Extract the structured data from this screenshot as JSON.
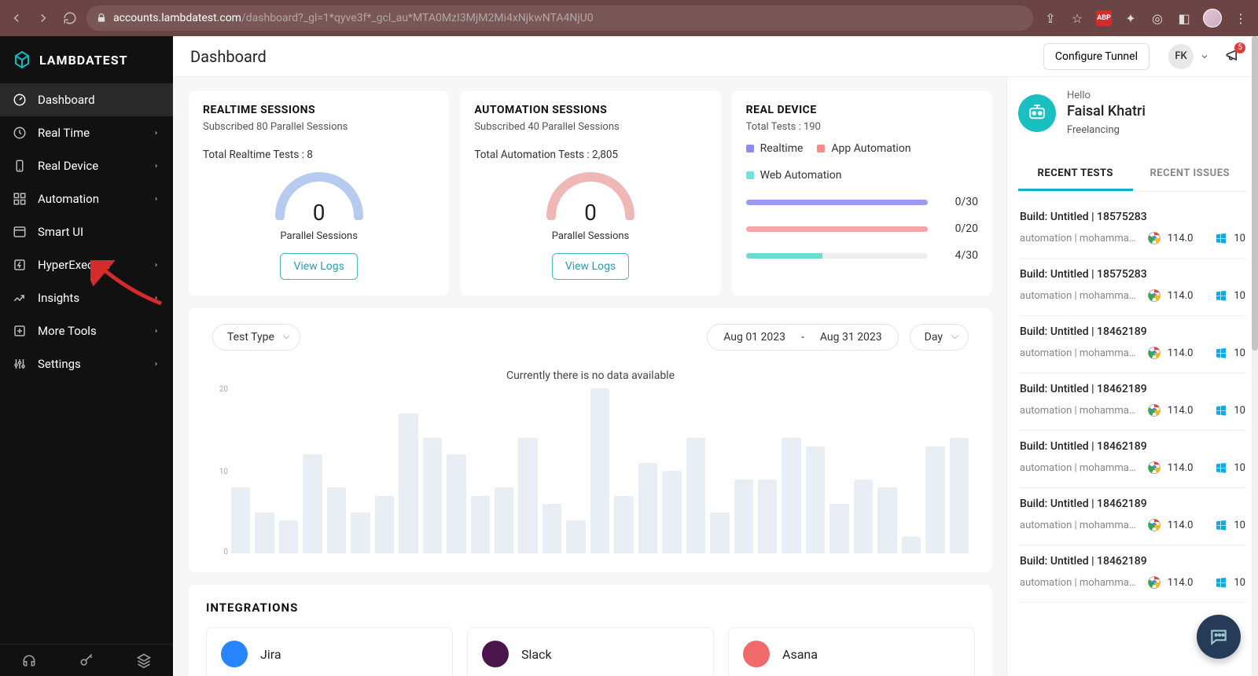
{
  "browser": {
    "url_host": "accounts.lambdatest.com",
    "url_path": "/dashboard?_gl=1*qyve3f*_gcl_au*MTA0MzI3MjM2Mi4xNjkwNTA4NjU0"
  },
  "brand": "LAMBDATEST",
  "page_title": "Dashboard",
  "configure_tunnel": "Configure Tunnel",
  "user_initials": "FK",
  "notifications_count": "5",
  "sidebar": {
    "items": [
      {
        "label": "Dashboard",
        "icon": "gauge",
        "active": true,
        "chevron": false
      },
      {
        "label": "Real Time",
        "icon": "clock",
        "active": false,
        "chevron": true
      },
      {
        "label": "Real Device",
        "icon": "device",
        "active": false,
        "chevron": true
      },
      {
        "label": "Automation",
        "icon": "grid",
        "active": false,
        "chevron": true
      },
      {
        "label": "Smart UI",
        "icon": "window",
        "active": false,
        "chevron": false
      },
      {
        "label": "HyperExecute",
        "icon": "lightning",
        "active": false,
        "chevron": true
      },
      {
        "label": "Insights",
        "icon": "trend",
        "active": false,
        "chevron": true
      },
      {
        "label": "More Tools",
        "icon": "plus",
        "active": false,
        "chevron": true
      },
      {
        "label": "Settings",
        "icon": "sliders",
        "active": false,
        "chevron": true
      }
    ]
  },
  "realtime": {
    "title": "REALTIME SESSIONS",
    "sub": "Subscribed 80 Parallel Sessions",
    "total_label": "Total Realtime Tests :",
    "total_value": "8",
    "gauge_value": "0",
    "gauge_label": "Parallel Sessions",
    "button": "View Logs",
    "gauge_color": "#b7caf0"
  },
  "automation": {
    "title": "AUTOMATION SESSIONS",
    "sub": "Subscribed 40 Parallel Sessions",
    "total_label": "Total Automation Tests :",
    "total_value": "2,805",
    "gauge_value": "0",
    "gauge_label": "Parallel Sessions",
    "button": "View Logs",
    "gauge_color": "#f0b7b7"
  },
  "device": {
    "title": "REAL DEVICE",
    "sub": "Total Tests : 190",
    "legend": [
      {
        "label": "Realtime",
        "color": "#8b8bf5"
      },
      {
        "label": "App Automation",
        "color": "#f58b8b"
      },
      {
        "label": "Web Automation",
        "color": "#6ee3d8"
      }
    ],
    "bars": [
      {
        "color": "#9a9af5",
        "value": "0/30",
        "fill": 100
      },
      {
        "color": "#f5a5a5",
        "value": "0/20",
        "fill": 100
      },
      {
        "color": "#6adcd0",
        "value": "4/30",
        "fill": 42
      }
    ]
  },
  "chart": {
    "test_type_label": "Test Type",
    "date_from": "Aug 01 2023",
    "date_dash": "-",
    "date_to": "Aug 31 2023",
    "granularity": "Day",
    "nodata": "Currently there is no data available",
    "yticks": [
      "20",
      "10",
      "0"
    ]
  },
  "integrations": {
    "title": "INTEGRATIONS",
    "items": [
      {
        "name": "Jira",
        "color": "#2684ff"
      },
      {
        "name": "Slack",
        "color": "#4a154b"
      },
      {
        "name": "Asana",
        "color": "#f06a6a"
      }
    ]
  },
  "profile": {
    "hello": "Hello",
    "name": "Faisal Khatri",
    "role": "Freelancing"
  },
  "tabs": {
    "tests": "RECENT TESTS",
    "issues": "RECENT ISSUES"
  },
  "recent_tests": [
    {
      "build": "Build: Untitled | 18575283",
      "meta": "automation | mohammad...",
      "browser_v": "114.0",
      "os_v": "10"
    },
    {
      "build": "Build: Untitled | 18575283",
      "meta": "automation | mohammad...",
      "browser_v": "114.0",
      "os_v": "10"
    },
    {
      "build": "Build: Untitled | 18462189",
      "meta": "automation | mohammad...",
      "browser_v": "114.0",
      "os_v": "10"
    },
    {
      "build": "Build: Untitled | 18462189",
      "meta": "automation | mohammad...",
      "browser_v": "114.0",
      "os_v": "10"
    },
    {
      "build": "Build: Untitled | 18462189",
      "meta": "automation | mohammad...",
      "browser_v": "114.0",
      "os_v": "10"
    },
    {
      "build": "Build: Untitled | 18462189",
      "meta": "automation | mohammad...",
      "browser_v": "114.0",
      "os_v": "10"
    },
    {
      "build": "Build: Untitled | 18462189",
      "meta": "automation | mohammad...",
      "browser_v": "114.0",
      "os_v": "10"
    }
  ],
  "chart_data": {
    "type": "bar",
    "title": "",
    "xlabel": "",
    "ylabel": "",
    "ylim": [
      0,
      20
    ],
    "values": [
      8,
      5,
      4,
      12,
      8,
      5,
      7,
      17,
      14,
      12,
      7,
      8,
      14,
      6,
      4,
      20,
      7,
      11,
      10,
      14,
      5,
      9,
      9,
      14,
      13,
      6,
      9,
      8,
      2,
      13,
      14
    ]
  }
}
